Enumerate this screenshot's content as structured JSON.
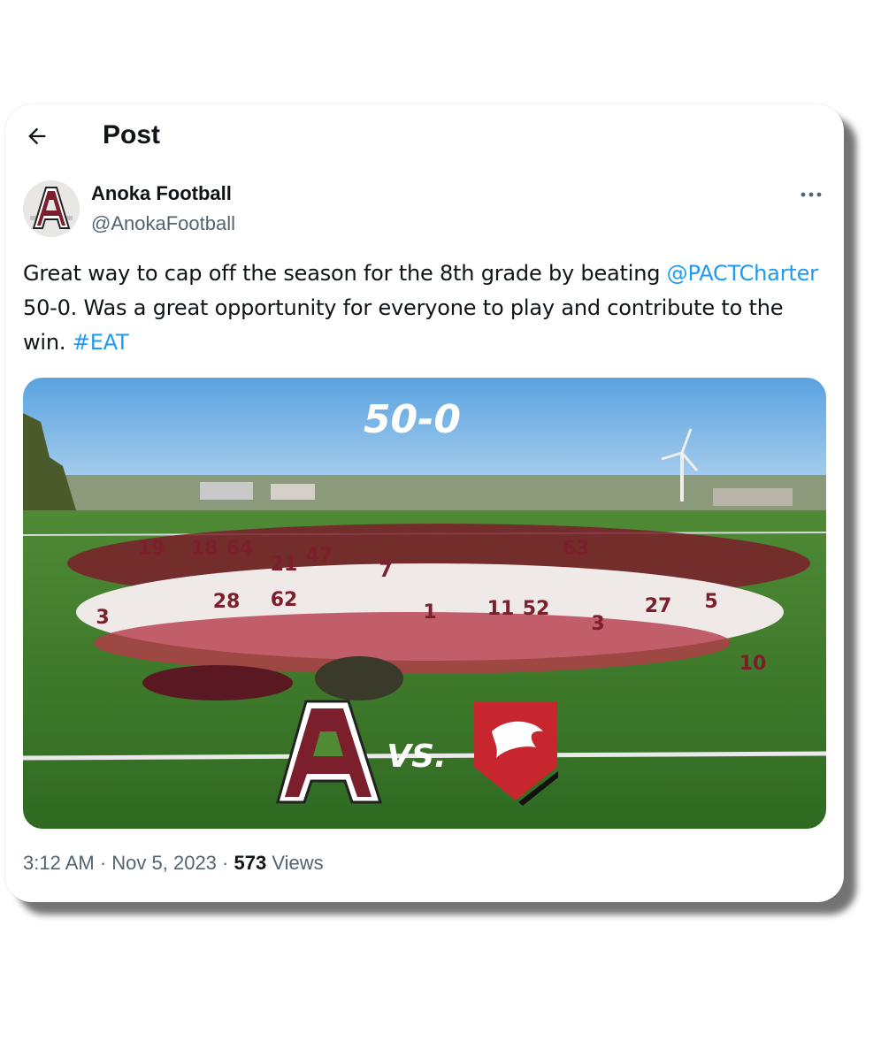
{
  "header": {
    "title": "Post"
  },
  "author": {
    "display_name": "Anoka Football",
    "handle": "@AnokaFootball"
  },
  "tweet": {
    "text_part1": "Great way to cap off the season for the 8th grade by beating ",
    "mention": "@PACTCharter",
    "text_part2": " 50-0. Was a great opportunity for everyone to play and contribute to the win. ",
    "hashtag": "#EAT"
  },
  "media": {
    "score_text": "50-0",
    "vs_text": "VS.",
    "logo_letter": "A",
    "jersey_numbers": [
      "19",
      "18",
      "64",
      "21",
      "47",
      "7",
      "3",
      "28",
      "62",
      "1",
      "11",
      "52",
      "3",
      "27",
      "5",
      "63",
      "10"
    ]
  },
  "meta": {
    "time": "3:12 AM",
    "separator": " · ",
    "date": "Nov 5, 2023",
    "views_count": "573",
    "views_label": " Views"
  },
  "colors": {
    "accent_link": "#1d9bf0",
    "maroon": "#7a1f2b",
    "field_green": "#3e7a2a",
    "sky": "#7fb6e6"
  },
  "icons": {
    "back": "arrow-left-icon",
    "more": "more-horizontal-icon"
  }
}
